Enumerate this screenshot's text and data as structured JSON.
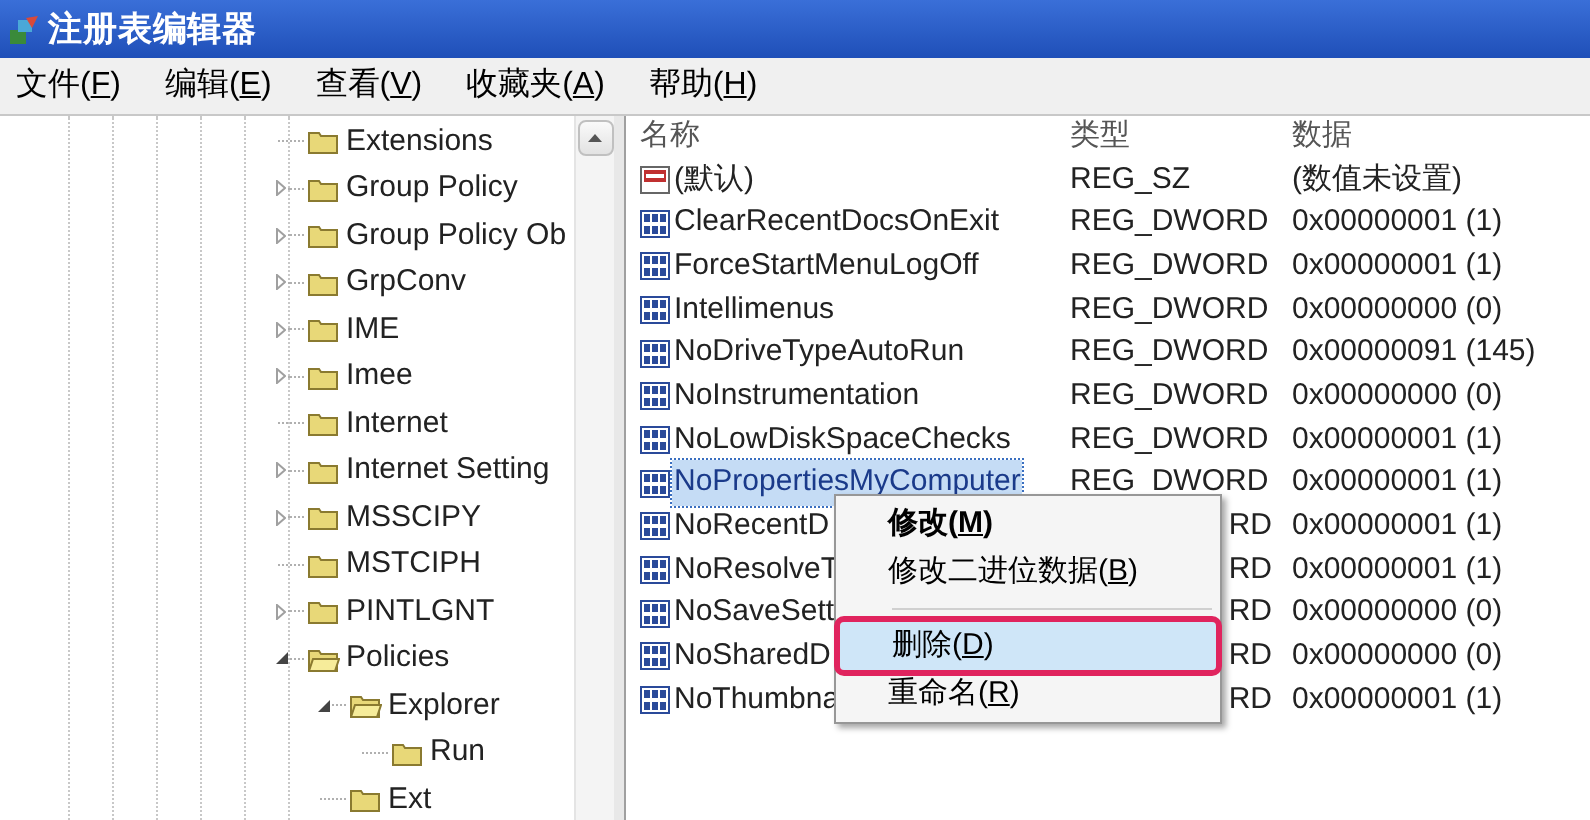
{
  "window": {
    "title": "注册表编辑器"
  },
  "menu_bar": [
    "文件(F)",
    "编辑(E)",
    "查看(V)",
    "收藏夹(A)",
    "帮助(H)"
  ],
  "tree": {
    "items": [
      {
        "label": "Extensions"
      },
      {
        "label": "Group Policy",
        "expanded": false
      },
      {
        "label": "Group Policy Ob",
        "expanded": false
      },
      {
        "label": "GrpConv",
        "expanded": false
      },
      {
        "label": "IME",
        "expanded": false
      },
      {
        "label": "Imee",
        "expanded": false
      },
      {
        "label": "Internet"
      },
      {
        "label": "Internet Setting",
        "expanded": false
      },
      {
        "label": "MSSCIPY",
        "expanded": false
      },
      {
        "label": "MSTCIPH"
      },
      {
        "label": "PINTLGNT",
        "expanded": false
      },
      {
        "label": "Policies",
        "expanded": true,
        "children": [
          {
            "label": "Explorer",
            "expanded": true,
            "children": [
              {
                "label": "Run"
              }
            ]
          },
          {
            "label": "Ext"
          }
        ]
      }
    ]
  },
  "values": {
    "columns": [
      "名称",
      "类型",
      "数据"
    ],
    "rows": [
      {
        "kind": "string",
        "name": "(默认)",
        "type": "REG_SZ",
        "data": "(数值未设置)",
        "selected": false
      },
      {
        "kind": "dword",
        "name": "ClearRecentDocsOnExit",
        "type": "REG_DWORD",
        "data": "0x00000001 (1)",
        "selected": false
      },
      {
        "kind": "dword",
        "name": "ForceStartMenuLogOff",
        "type": "REG_DWORD",
        "data": "0x00000001 (1)",
        "selected": false
      },
      {
        "kind": "dword",
        "name": "Intellimenus",
        "type": "REG_DWORD",
        "data": "0x00000000 (0)",
        "selected": false
      },
      {
        "kind": "dword",
        "name": "NoDriveTypeAutoRun",
        "type": "REG_DWORD",
        "data": "0x00000091 (145)",
        "selected": false
      },
      {
        "kind": "dword",
        "name": "NoInstrumentation",
        "type": "REG_DWORD",
        "data": "0x00000000 (0)",
        "selected": false
      },
      {
        "kind": "dword",
        "name": "NoLowDiskSpaceChecks",
        "type": "REG_DWORD",
        "data": "0x00000001 (1)",
        "selected": false
      },
      {
        "kind": "dword",
        "name": "NoPropertiesMyComputer",
        "type": "REG_DWORD",
        "data": "0x00000001 (1)",
        "selected": true
      },
      {
        "kind": "dword",
        "name": "NoRecentD",
        "type": "RD",
        "data": "0x00000001 (1)",
        "selected": false,
        "partly_hidden": true
      },
      {
        "kind": "dword",
        "name": "NoResolveT",
        "type": "RD",
        "data": "0x00000001 (1)",
        "selected": false,
        "partly_hidden": true
      },
      {
        "kind": "dword",
        "name": "NoSaveSett",
        "type": "RD",
        "data": "0x00000000 (0)",
        "selected": false,
        "partly_hidden": true
      },
      {
        "kind": "dword",
        "name": "NoSharedD",
        "type": "RD",
        "data": "0x00000000 (0)",
        "selected": false,
        "partly_hidden": true
      },
      {
        "kind": "dword",
        "name": "NoThumbna",
        "type": "RD",
        "data": "0x00000001 (1)",
        "selected": false,
        "partly_hidden": true
      }
    ]
  },
  "context_menu": {
    "items": [
      {
        "kind": "item",
        "label": "修改(M)",
        "default": true,
        "selected": false
      },
      {
        "kind": "item",
        "label": "修改二进位数据(B)",
        "default": false,
        "selected": false
      },
      {
        "kind": "separator"
      },
      {
        "kind": "item",
        "label": "删除(D)",
        "default": false,
        "selected": true
      },
      {
        "kind": "item",
        "label": "重命名(R)",
        "default": false,
        "selected": false
      }
    ]
  }
}
